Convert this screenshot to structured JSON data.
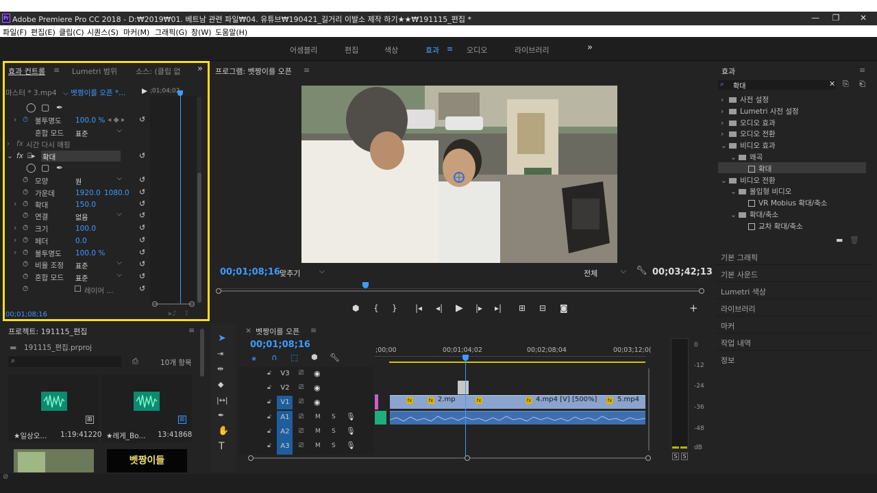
{
  "title_bar": {
    "text": "Adobe Premiere Pro CC 2018 - D:₩2019₩01. 베트남 관련 파일₩04. 유튜브₩190421_길거리 이발소 제작 하기★★₩191115_편집 *"
  },
  "menu": [
    "파일(F)",
    "편집(E)",
    "클립(C)",
    "시퀀스(S)",
    "마커(M)",
    "그래픽(G)",
    "창(W)",
    "도움말(H)"
  ],
  "workspaces": [
    "어셈블리",
    "편집",
    "색상",
    "효과",
    "오디오",
    "라이브러리"
  ],
  "workspace_more": "»",
  "colors": {
    "accent": "#3d9bff",
    "highlight_box": "#f5e11a",
    "fx_badge": "#d8b400",
    "video_clip": "#8ba4cf",
    "audio_clip": "#3f6fae"
  },
  "effect_controls": {
    "tabs": [
      "효과 컨트롤",
      "Lumetri 범위",
      "소스: (클립 없"
    ],
    "master": "마스터 * 3.mp4",
    "sequence": "벳짱이를 오픈 *...",
    "mini_time": ";01;04;02",
    "opacity_label": "불투명도",
    "opacity_value": "100.0 %",
    "blend_label": "혼합 모드",
    "blend_value": "표준",
    "time_remap": "시간 다시 매핑",
    "magnify_label": "확대",
    "params": [
      {
        "label": "모양",
        "value": "원",
        "kind": "select"
      },
      {
        "label": "가운데",
        "value": "1920.0",
        "value2": "1080.0",
        "kind": "num"
      },
      {
        "label": "확대",
        "value": "150.0",
        "kind": "num"
      },
      {
        "label": "연결",
        "value": "없음",
        "kind": "select"
      },
      {
        "label": "크기",
        "value": "100.0",
        "kind": "num"
      },
      {
        "label": "페더",
        "value": "0.0",
        "kind": "num"
      },
      {
        "label": "불투명도",
        "value": "100.0 %",
        "kind": "num"
      },
      {
        "label": "비율 조정",
        "value": "표준",
        "kind": "select"
      },
      {
        "label": "혼합 모드",
        "value": "표준",
        "kind": "select"
      }
    ],
    "layer_label": "레이어 ...",
    "timecode": "00;01;08;16"
  },
  "program": {
    "title": "프로그램: 벳짱이를 오픈",
    "timecode": "00;01;08;16",
    "fit": "맞추기",
    "quality": "전체",
    "duration": "00;03;42;13"
  },
  "project": {
    "title": "프로젝트: 191115_편집",
    "file": "191115_편집.prproj",
    "count": "10개 항목",
    "items": [
      {
        "name": "★일상오...",
        "duration": "1:19:41220"
      },
      {
        "name": "★레게_Bo...",
        "duration": "13:41868"
      }
    ],
    "thumb_text": "벳짱이들"
  },
  "timeline": {
    "title": "벳짱이를 오픈",
    "timecode": "00;01;08;16",
    "ruler": [
      ";00;00",
      "00;01;04;02",
      "00;02;08;04",
      "00;03;12;0("
    ],
    "tracks": [
      "V3",
      "V2",
      "V1",
      "A1",
      "A2",
      "A3"
    ],
    "clip_labels": [
      "2.mp",
      "4.mp4 [V] [500%]",
      "5.mp4"
    ]
  },
  "meter": {
    "scale": [
      "0",
      "-12",
      "-24",
      "-36",
      "-48",
      "dB"
    ],
    "solo": [
      "S",
      "S"
    ]
  },
  "effects": {
    "title": "효과",
    "search": "확대",
    "tree": [
      {
        "label": "사전 설정",
        "indent": 0,
        "arrow": "›"
      },
      {
        "label": "Lumetri 사전 설정",
        "indent": 0,
        "arrow": "›"
      },
      {
        "label": "오디오 효과",
        "indent": 0,
        "arrow": "›"
      },
      {
        "label": "오디오 전환",
        "indent": 0,
        "arrow": "›"
      },
      {
        "label": "비디오 효과",
        "indent": 0,
        "arrow": "⌄"
      },
      {
        "label": "왜곡",
        "indent": 1,
        "arrow": "⌄"
      },
      {
        "label": "확대",
        "indent": 2,
        "arrow": ""
      },
      {
        "label": "비디오 전환",
        "indent": 0,
        "arrow": "⌄"
      },
      {
        "label": "몰입형 비디오",
        "indent": 1,
        "arrow": "⌄"
      },
      {
        "label": "VR Mobius 확대/축소",
        "indent": 2,
        "arrow": ""
      },
      {
        "label": "확대/축소",
        "indent": 1,
        "arrow": "⌄"
      },
      {
        "label": "교차 확대/축소",
        "indent": 2,
        "arrow": ""
      }
    ],
    "collapsed_panels": [
      "기본 그래픽",
      "기본 사운드",
      "Lumetri 색상",
      "라이브러리",
      "마커",
      "작업 내역",
      "정보"
    ]
  }
}
